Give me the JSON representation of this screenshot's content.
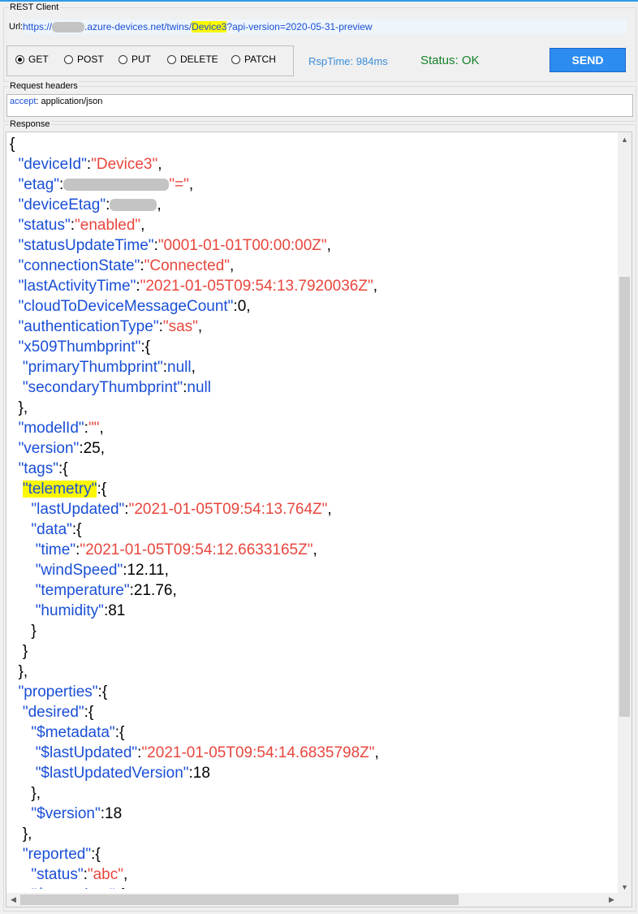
{
  "app": {
    "title": "REST Client"
  },
  "url": {
    "label": "Url:",
    "prefix": "https://",
    "host_visible": ".azure-devices.net/twins/",
    "device_path": "Device3",
    "suffix": "?api-version=2020-05-31-preview"
  },
  "methods": [
    {
      "label": "GET",
      "selected": true
    },
    {
      "label": "POST",
      "selected": false
    },
    {
      "label": "PUT",
      "selected": false
    },
    {
      "label": "DELETE",
      "selected": false
    },
    {
      "label": "PATCH",
      "selected": false
    }
  ],
  "response_time": "RspTime: 984ms",
  "status": "Status: OK",
  "send_label": "SEND",
  "request_headers": {
    "title": "Request headers",
    "key": "accept",
    "value": ": application/json"
  },
  "response": {
    "title": "Response",
    "lines": [
      [
        [
          "p",
          "{"
        ]
      ],
      [
        [
          "p",
          "  "
        ],
        [
          "k",
          "\"deviceId\""
        ],
        [
          "p",
          ":"
        ],
        [
          "s",
          "\"Device3\""
        ],
        [
          "p",
          ","
        ]
      ],
      [
        [
          "p",
          "  "
        ],
        [
          "k",
          "\"etag\""
        ],
        [
          "p",
          ":"
        ],
        [
          "r",
          "130"
        ],
        [
          "s",
          "\"=\""
        ],
        [
          "p",
          ","
        ]
      ],
      [
        [
          "p",
          "  "
        ],
        [
          "k",
          "\"deviceEtag\""
        ],
        [
          "p",
          ":"
        ],
        [
          "r",
          "58"
        ],
        [
          "p",
          ","
        ]
      ],
      [
        [
          "p",
          "  "
        ],
        [
          "k",
          "\"status\""
        ],
        [
          "p",
          ":"
        ],
        [
          "s",
          "\"enabled\""
        ],
        [
          "p",
          ","
        ]
      ],
      [
        [
          "p",
          "  "
        ],
        [
          "k",
          "\"statusUpdateTime\""
        ],
        [
          "p",
          ":"
        ],
        [
          "s",
          "\"0001-01-01T00:00:00Z\""
        ],
        [
          "p",
          ","
        ]
      ],
      [
        [
          "p",
          "  "
        ],
        [
          "k",
          "\"connectionState\""
        ],
        [
          "p",
          ":"
        ],
        [
          "s",
          "\"Connected\""
        ],
        [
          "p",
          ","
        ]
      ],
      [
        [
          "p",
          "  "
        ],
        [
          "k",
          "\"lastActivityTime\""
        ],
        [
          "p",
          ":"
        ],
        [
          "s",
          "\"2021-01-05T09:54:13.7920036Z\""
        ],
        [
          "p",
          ","
        ]
      ],
      [
        [
          "p",
          "  "
        ],
        [
          "k",
          "\"cloudToDeviceMessageCount\""
        ],
        [
          "p",
          ":0,"
        ]
      ],
      [
        [
          "p",
          "  "
        ],
        [
          "k",
          "\"authenticationType\""
        ],
        [
          "p",
          ":"
        ],
        [
          "s",
          "\"sas\""
        ],
        [
          "p",
          ","
        ]
      ],
      [
        [
          "p",
          "  "
        ],
        [
          "k",
          "\"x509Thumbprint\""
        ],
        [
          "p",
          ":{"
        ]
      ],
      [
        [
          "p",
          "   "
        ],
        [
          "k",
          "\"primaryThumbprint\""
        ],
        [
          "p",
          ":"
        ],
        [
          "l",
          "null"
        ],
        [
          "p",
          ","
        ]
      ],
      [
        [
          "p",
          "   "
        ],
        [
          "k",
          "\"secondaryThumbprint\""
        ],
        [
          "p",
          ":"
        ],
        [
          "l",
          "null"
        ]
      ],
      [
        [
          "p",
          "  },"
        ]
      ],
      [
        [
          "p",
          "  "
        ],
        [
          "k",
          "\"modelId\""
        ],
        [
          "p",
          ":"
        ],
        [
          "s",
          "\"\""
        ],
        [
          "p",
          ","
        ]
      ],
      [
        [
          "p",
          "  "
        ],
        [
          "k",
          "\"version\""
        ],
        [
          "p",
          ":25,"
        ]
      ],
      [
        [
          "p",
          "  "
        ],
        [
          "k",
          "\"tags\""
        ],
        [
          "p",
          ":{"
        ]
      ],
      [
        [
          "p",
          "   "
        ],
        [
          "h",
          "\"telemetry\""
        ],
        [
          "p",
          ":{"
        ]
      ],
      [
        [
          "p",
          "     "
        ],
        [
          "k",
          "\"lastUpdated\""
        ],
        [
          "p",
          ":"
        ],
        [
          "s",
          "\"2021-01-05T09:54:13.764Z\""
        ],
        [
          "p",
          ","
        ]
      ],
      [
        [
          "p",
          "     "
        ],
        [
          "k",
          "\"data\""
        ],
        [
          "p",
          ":{"
        ]
      ],
      [
        [
          "p",
          "      "
        ],
        [
          "k",
          "\"time\""
        ],
        [
          "p",
          ":"
        ],
        [
          "s",
          "\"2021-01-05T09:54:12.6633165Z\""
        ],
        [
          "p",
          ","
        ]
      ],
      [
        [
          "p",
          "      "
        ],
        [
          "k",
          "\"windSpeed\""
        ],
        [
          "p",
          ":12.11,"
        ]
      ],
      [
        [
          "p",
          "      "
        ],
        [
          "k",
          "\"temperature\""
        ],
        [
          "p",
          ":21.76,"
        ]
      ],
      [
        [
          "p",
          "      "
        ],
        [
          "k",
          "\"humidity\""
        ],
        [
          "p",
          ":81"
        ]
      ],
      [
        [
          "p",
          "     }"
        ]
      ],
      [
        [
          "p",
          "   }"
        ]
      ],
      [
        [
          "p",
          "  },"
        ]
      ],
      [
        [
          "p",
          "  "
        ],
        [
          "k",
          "\"properties\""
        ],
        [
          "p",
          ":{"
        ]
      ],
      [
        [
          "p",
          "   "
        ],
        [
          "k",
          "\"desired\""
        ],
        [
          "p",
          ":{"
        ]
      ],
      [
        [
          "p",
          "     "
        ],
        [
          "k",
          "\"$metadata\""
        ],
        [
          "p",
          ":{"
        ]
      ],
      [
        [
          "p",
          "      "
        ],
        [
          "k",
          "\"$lastUpdated\""
        ],
        [
          "p",
          ":"
        ],
        [
          "s",
          "\"2021-01-05T09:54:14.6835798Z\""
        ],
        [
          "p",
          ","
        ]
      ],
      [
        [
          "p",
          "      "
        ],
        [
          "k",
          "\"$lastUpdatedVersion\""
        ],
        [
          "p",
          ":18"
        ]
      ],
      [
        [
          "p",
          "     },"
        ]
      ],
      [
        [
          "p",
          "     "
        ],
        [
          "k",
          "\"$version\""
        ],
        [
          "p",
          ":18"
        ]
      ],
      [
        [
          "p",
          "   },"
        ]
      ],
      [
        [
          "p",
          "   "
        ],
        [
          "k",
          "\"reported\""
        ],
        [
          "p",
          ":{"
        ]
      ],
      [
        [
          "p",
          "     "
        ],
        [
          "k",
          "\"status\""
        ],
        [
          "p",
          ":"
        ],
        [
          "s",
          "\"abc\""
        ],
        [
          "p",
          ","
        ]
      ],
      [
        [
          "p",
          "     "
        ],
        [
          "k",
          "\"$metadata\""
        ],
        [
          "p",
          ":{"
        ]
      ]
    ]
  },
  "colors": {
    "key": "#1a4fd6",
    "string": "#e8473e",
    "status_ok": "#15822a",
    "send_button": "#2c8cf0",
    "highlight": "#fbf800"
  }
}
